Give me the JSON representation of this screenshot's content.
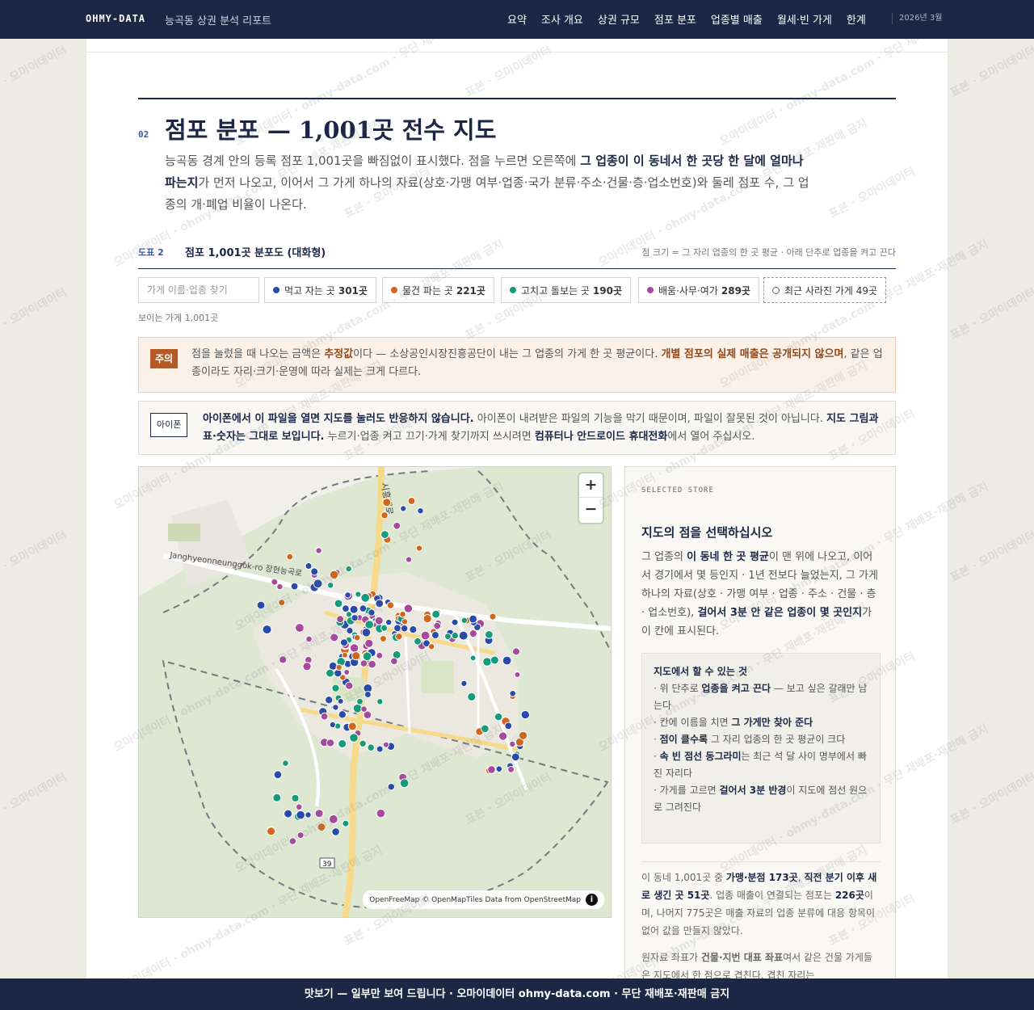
{
  "nav": {
    "brand": "OHMY-DATA",
    "report_title": "능곡동 상권 분석 리포트",
    "links": [
      "요약",
      "조사 개요",
      "상권 규모",
      "점포 분포",
      "업종별 매출",
      "월세·빈 가게",
      "한계"
    ],
    "date": "2026년 3월"
  },
  "section": {
    "number": "02",
    "title": "점포 분포 — 1,001곳 전수 지도",
    "lead_1": "능곡동 경계 안의 등록 점포 1,001곳을 빠짐없이 표시했다. 점을 누르면 오른쪽에 ",
    "lead_bold": "그 업종이 이 동네서 한 곳당 한 달에 얼마나 파는지",
    "lead_2": "가 먼저 나오고, 이어서 그 가게 하나의 자료(상호·가맹 여부·업종·국가 분류·주소·건물·층·업소번호)와 둘레 점포 수, 그 업종의 개·폐업 비율이 나온다."
  },
  "figure": {
    "label": "도표 2",
    "title": "점포 1,001곳 분포도 (대화형)",
    "note": "점 크기 = 그 자리 업종의 한 곳 평균 · 아래 단추로 업종을 켜고 끈다"
  },
  "filters": {
    "search_placeholder": "가게 이름·업종 찾기",
    "chips": [
      {
        "label": "먹고 자는 곳",
        "count": "301곳",
        "color": "#2a4aa8"
      },
      {
        "label": "물건 파는 곳",
        "count": "221곳",
        "color": "#d0671c"
      },
      {
        "label": "고치고 돌보는 곳",
        "count": "190곳",
        "color": "#159a7a"
      },
      {
        "label": "배움·사무·여가",
        "count": "289곳",
        "color": "#a54a9c"
      }
    ],
    "closed_chip": "최근 사라진 가게 49곳",
    "visible_count": "보이는 가게 1,001곳"
  },
  "warning": {
    "tag": "주의",
    "text_1": "점을 눌렀을 때 나오는 금액은 ",
    "bold_1": "추정값",
    "text_2": "이다 — 소상공인시장진흥공단이 내는 그 업종의 가게 한 곳 평균이다. ",
    "bold_2": "개별 점포의 실제 매출은 공개되지 않으며",
    "text_3": ", 같은 업종이라도 자리·크기·운영에 따라 실제는 크게 다르다."
  },
  "ios_notice": {
    "tag": "아이폰",
    "bold_1": "아이폰에서 이 파일을 열면 지도를 눌러도 반응하지 않습니다.",
    "text_1": " 아이폰이 내려받은 파일의 기능을 막기 때문이며, 파일이 잘못된 것이 아닙니다. ",
    "bold_2": "지도 그림과 표·숫자는 그대로 보입니다.",
    "text_2": " 누르기·업종 켜고 끄기·가게 찾기까지 쓰시려면 ",
    "bold_3": "컴퓨터나 안드로이드 휴대전화",
    "text_3": "에서 열어 주십시오."
  },
  "map": {
    "zoom_in": "+",
    "zoom_out": "−",
    "road_label": "Janghyeonneunggok-ro 장현능곡로",
    "road_label_2": "시흥대로",
    "route_number": "39",
    "attribution": "OpenFreeMap © OpenMapTiles Data from OpenStreetMap",
    "info": "i"
  },
  "panel": {
    "eyebrow": "SELECTED STORE",
    "title": "지도의 점을 선택하십시오",
    "body_1": "그 업종의 ",
    "body_b1": "이 동네 한 곳 평균",
    "body_2": "이 맨 위에 나오고, 이어서 경기에서 몇 등인지 · 1년 전보다 늘었는지, 그 가게 하나의 자료(상호 · 가맹 여부 · 업종 · 주소 · 건물 · 층 · 업소번호), ",
    "body_b2": "걸어서 3분 안 같은 업종이 몇 곳인지",
    "body_3": "가 이 칸에 표시된다.",
    "howto_title": "지도에서 할 수 있는 것",
    "howto_1a": "· 위 단추로 ",
    "howto_1b": "업종을 켜고 끈다",
    "howto_1c": " — 보고 싶은 갈래만 남는다",
    "howto_2a": "· 칸에 이름을 치면 ",
    "howto_2b": "그 가게만 찾아 준다",
    "howto_3a": "· ",
    "howto_3b": "점이 클수록",
    "howto_3c": " 그 자리 업종의 한 곳 평균이 크다",
    "howto_4a": "· ",
    "howto_4b": "속 빈 점선 동그라미",
    "howto_4c": "는 최근 석 달 사이 명부에서 빠진 자리다",
    "howto_5a": "· 가게를 고르면 ",
    "howto_5b": "걸어서 3분 반경",
    "howto_5c": "이 지도에 점선 원으로 그려진다",
    "stats_1": "이 동네 1,001곳 중 ",
    "stats_b1": "가맹·분점 173곳",
    "stats_2": ", ",
    "stats_b2": "직전 분기 이후 새로 생긴 곳 51곳",
    "stats_3": ". 업종 매출이 연결되는 점포는 ",
    "stats_b3": "226곳",
    "stats_4": "이며, 나머지 775곳은 매출 자료의 업종 분류에 대응 항목이 없어 값을 만들지 않았다.",
    "more_1": "원자료 좌표가 ",
    "more_b1": "건물·지번 대표 좌표",
    "more_2": "여서 같은 건물 가게들은 지도에서 한 점으로 겹친다. 겹친 자리는"
  },
  "footer": {
    "banner": "맛보기 — 일부만 보여 드립니다 · 오마이데이터 ohmy-data.com · 무단 재배포·재판매 금지"
  },
  "watermark": {
    "text_a": "표본 · 오마이데이터",
    "text_b": "오마이데이터 · ohmy-data.com · 무단 재배포·재판매 금지"
  }
}
